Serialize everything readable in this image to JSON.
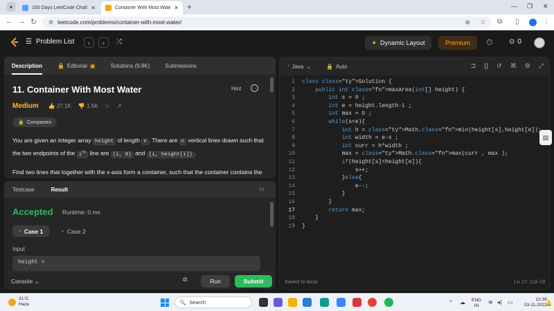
{
  "browser": {
    "tabs": [
      {
        "title": "100 Days LeetCode Challenge",
        "favicon_color": "#5aa0ff"
      },
      {
        "title": "Container With Most Water - L",
        "favicon_color": "#ffa116"
      }
    ],
    "url": "leetcode.com/problems/container-with-most-water/",
    "icons": {
      "back": "arrow-left-icon",
      "forward": "arrow-right-icon",
      "reload": "reload-icon",
      "zoom": "zoom-icon",
      "bookmark": "star-icon"
    }
  },
  "header": {
    "problem_list_label": "Problem List",
    "dynamic_layout_label": "Dynamic Layout",
    "premium_label": "Premium",
    "streak_count": "0"
  },
  "description_panel": {
    "tabs": [
      {
        "label": "Description"
      },
      {
        "label": "Editorial"
      },
      {
        "label": "Solutions (9.8K)"
      },
      {
        "label": "Submissions"
      }
    ],
    "title": "11. Container With Most Water",
    "hint_label": "Hint",
    "difficulty": "Medium",
    "likes": "27.1K",
    "dislikes": "1.5K",
    "companies_label": "Companies",
    "paragraph1": {
      "t1": "You are given an integer array ",
      "c1": "height",
      "t2": " of length ",
      "c2": "n",
      "t3": ". There are ",
      "c3": "n",
      "t4": " vertical lines drawn such that the two endpoints of the ",
      "c4": "i",
      "sup": "th",
      "t5": " line are ",
      "c5": "(i, 0)",
      "t6": " and ",
      "c6": "(i, height[i])",
      "t7": "."
    },
    "paragraph2": "Find two lines that together with the x-axis form a container, such that the container contains the most water."
  },
  "test_panel": {
    "tabs": [
      {
        "label": "Testcase"
      },
      {
        "label": "Result"
      }
    ],
    "status": "Accepted",
    "runtime": "Runtime: 0 ms",
    "cases": [
      {
        "label": "Case 1"
      },
      {
        "label": "Case 2"
      }
    ],
    "input_label": "Input",
    "input_value": "height ="
  },
  "bottom_bar": {
    "console_label": "Console",
    "run_label": "Run",
    "submit_label": "Submit"
  },
  "editor": {
    "language": "Java",
    "mode": "Auto",
    "current_line": 17,
    "lines": [
      "class Solution {",
      "    public int maxArea(int[] height) {",
      "        int s = 0 ;",
      "        int e = height.length-1 ;",
      "        int max = 0 ;",
      "        while(s<e){",
      "            int h = Math.min(height[s],height[e]);",
      "            int width = e-s ;",
      "            int curr = h*width ;",
      "            max = Math.max(curr , max );",
      "            if(height[s]<height[e]){",
      "                s++;",
      "            }else{",
      "                e--;",
      "            }",
      "        }",
      "        return max;",
      "    }",
      "}"
    ],
    "saved_label": "Saved to local",
    "cursor_position": "Ln 17, Col 19"
  },
  "taskbar": {
    "temperature": "31°C",
    "weather": "Haze",
    "search_label": "Search",
    "lang_line1": "ENG",
    "lang_line2": "IN",
    "time": "12:39",
    "date": "03-11-2023"
  }
}
